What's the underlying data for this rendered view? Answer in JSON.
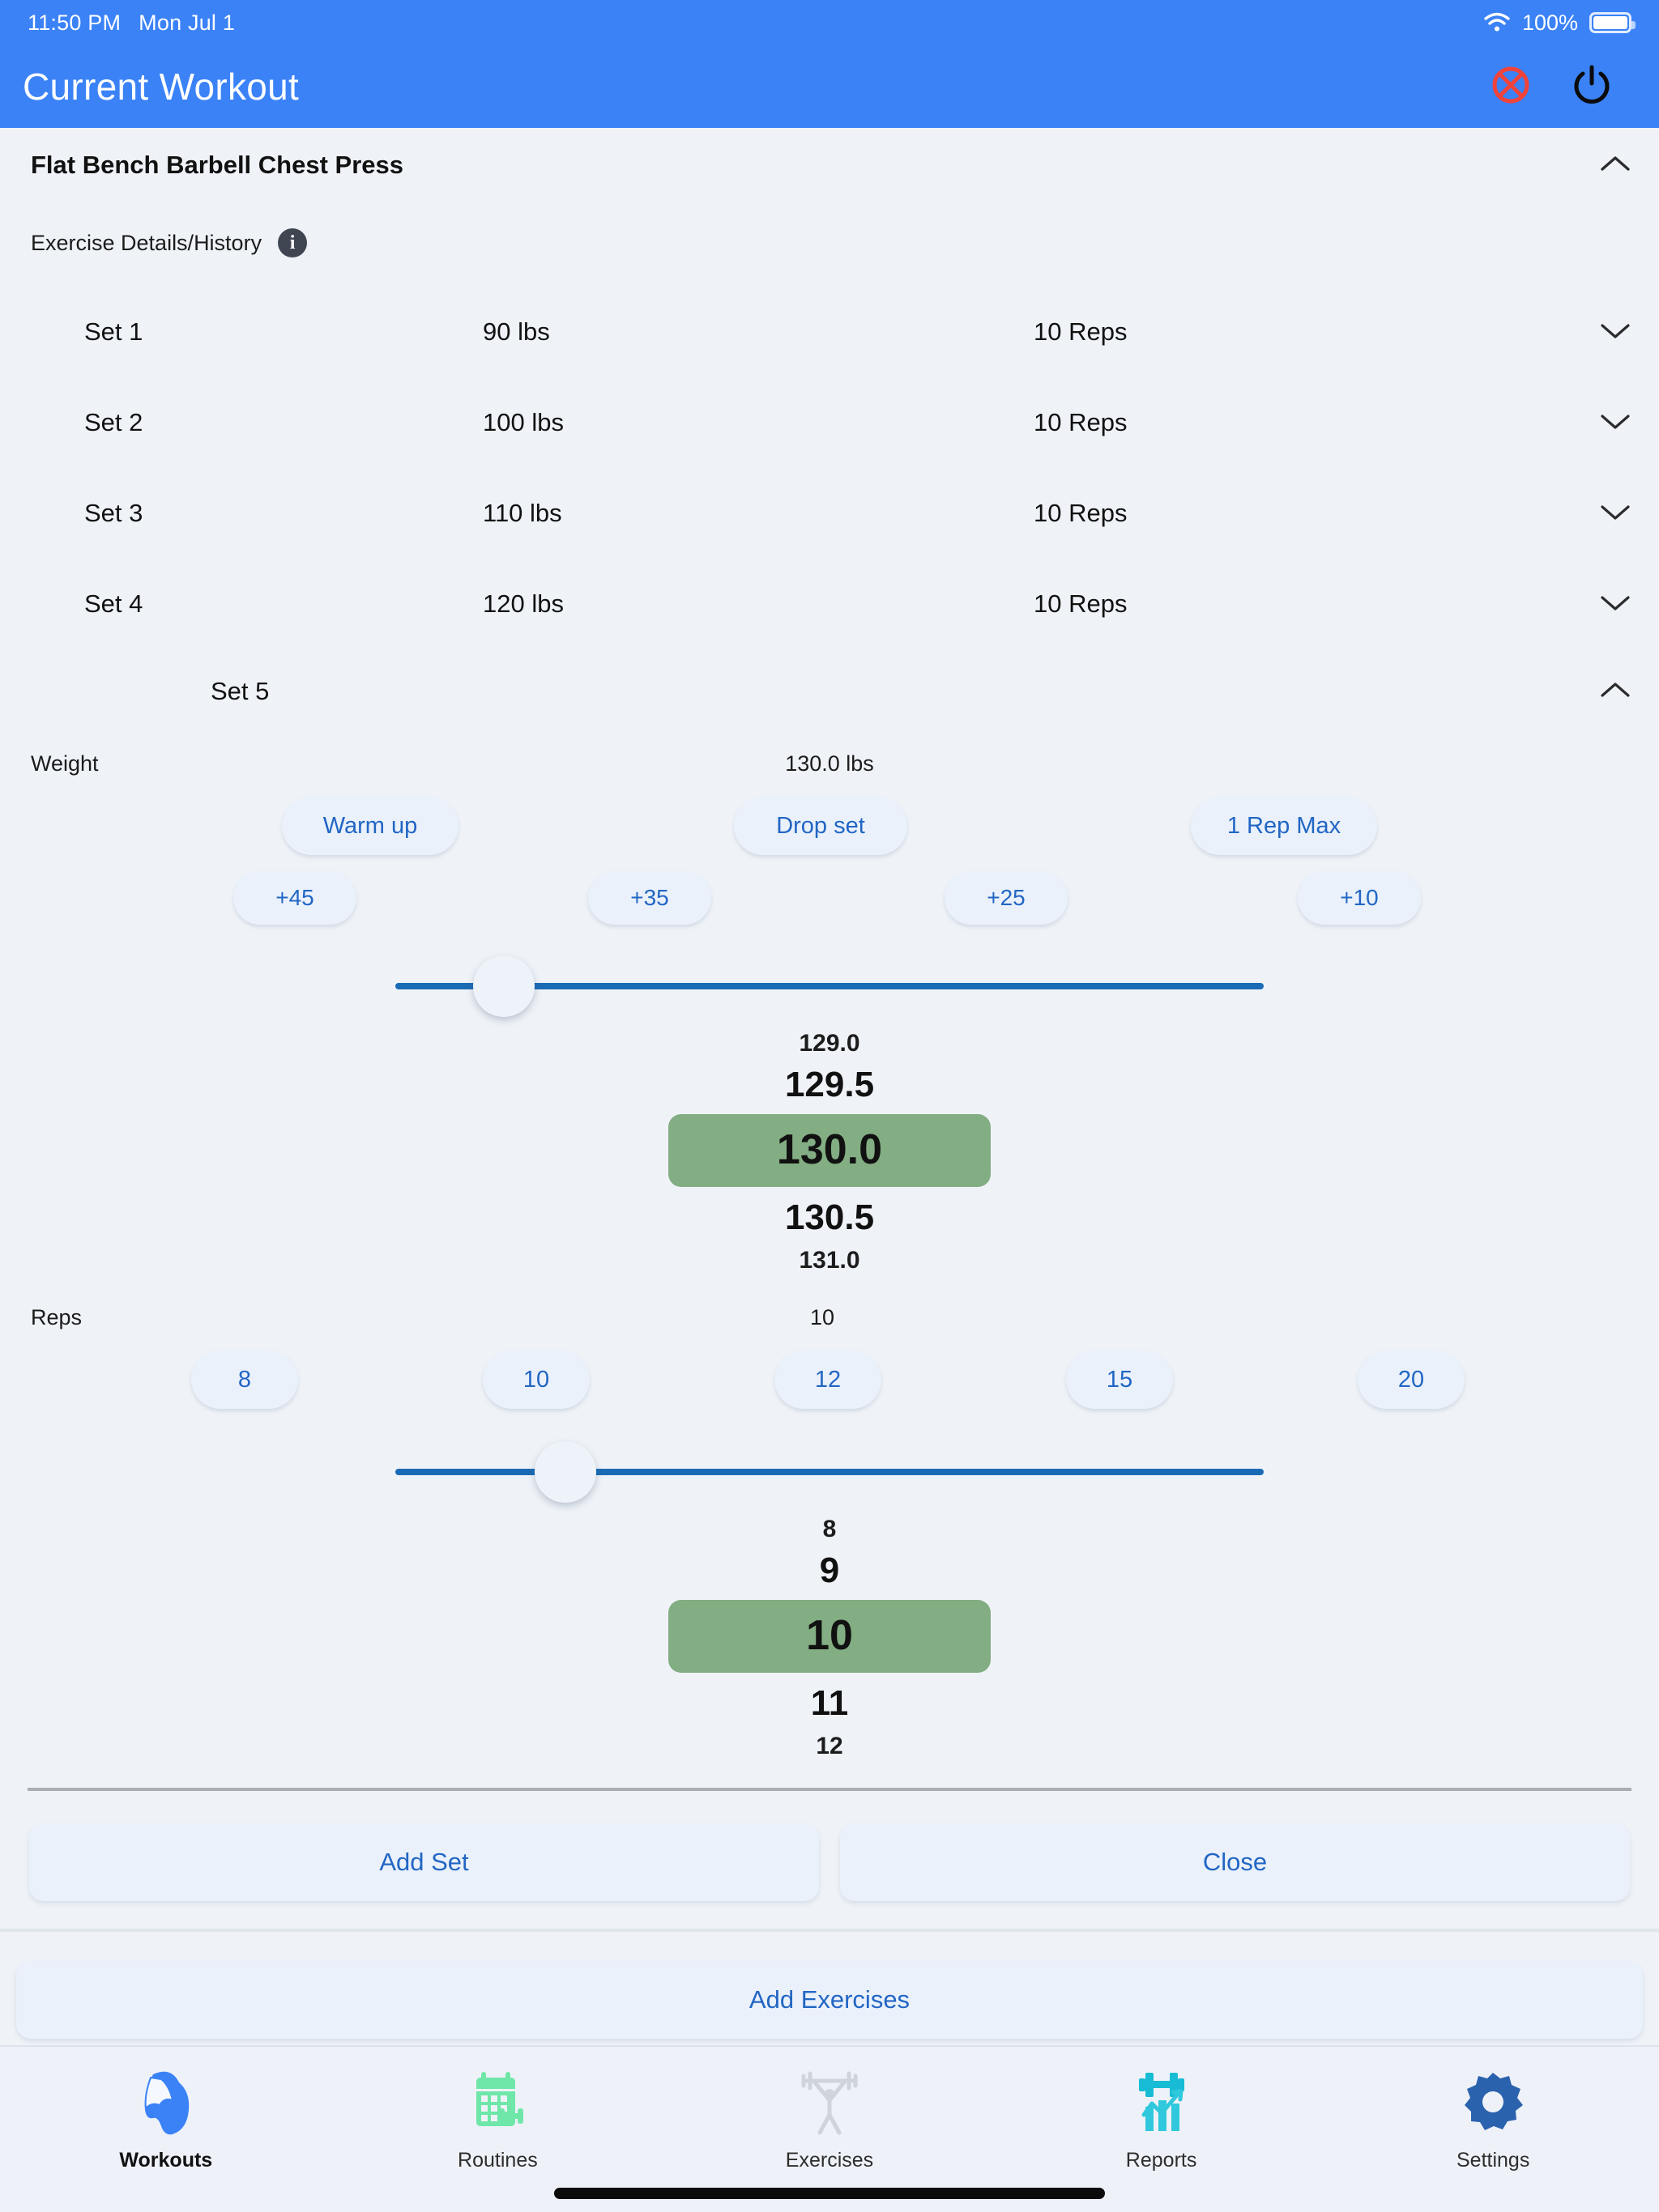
{
  "status_bar": {
    "time": "11:50 PM",
    "date": "Mon Jul 1",
    "battery_percent": "100%",
    "wifi_icon": "wifi-icon",
    "battery_icon": "battery-icon"
  },
  "nav": {
    "title": "Current Workout",
    "cancel_icon": "cancel-circle-x-icon",
    "power_icon": "power-icon",
    "accent": "#3b82f7"
  },
  "exercise": {
    "name": "Flat Bench Barbell Chest Press",
    "collapse_icon": "chevron-up-icon",
    "details_label": "Exercise Details/History",
    "info_icon": "info-icon"
  },
  "sets": [
    {
      "name": "Set 1",
      "weight": "90 lbs",
      "reps": "10 Reps",
      "chevron": "chevron-down-icon"
    },
    {
      "name": "Set 2",
      "weight": "100 lbs",
      "reps": "10 Reps",
      "chevron": "chevron-down-icon"
    },
    {
      "name": "Set 3",
      "weight": "110 lbs",
      "reps": "10 Reps",
      "chevron": "chevron-down-icon"
    },
    {
      "name": "Set 4",
      "weight": "120 lbs",
      "reps": "10 Reps",
      "chevron": "chevron-down-icon"
    }
  ],
  "active_set": {
    "name": "Set 5",
    "collapse_icon": "chevron-up-icon"
  },
  "weight": {
    "label": "Weight",
    "value": "130.0 lbs",
    "preset_buttons": [
      "Warm up",
      "Drop set",
      "1 Rep Max"
    ],
    "increment_buttons": [
      "+45",
      "+35",
      "+25",
      "+10"
    ],
    "picker": {
      "above_far": "129.0",
      "above_near": "129.5",
      "selected": "130.0",
      "below_near": "130.5",
      "below_far": "131.0",
      "selected_color": "#83ad83"
    },
    "slider": {
      "position_percent": 7
    }
  },
  "reps": {
    "label": "Reps",
    "value": "10",
    "quick_buttons": [
      "8",
      "10",
      "12",
      "15",
      "20"
    ],
    "picker": {
      "above_far": "8",
      "above_near": "9",
      "selected": "10",
      "below_near": "11",
      "below_far": "12",
      "selected_color": "#83ad83"
    },
    "slider": {
      "position_percent": 11
    }
  },
  "actions": {
    "add_set": "Add Set",
    "close": "Close",
    "add_exercises": "Add Exercises"
  },
  "tabbar": [
    {
      "label": "Workouts",
      "icon": "muscle-arm-icon",
      "active": true
    },
    {
      "label": "Routines",
      "icon": "calendar-dumbbell-icon",
      "active": false
    },
    {
      "label": "Exercises",
      "icon": "weightlifter-icon",
      "active": false
    },
    {
      "label": "Reports",
      "icon": "bar-chart-barbell-icon",
      "active": false
    },
    {
      "label": "Settings",
      "icon": "gear-icon",
      "active": false
    }
  ]
}
